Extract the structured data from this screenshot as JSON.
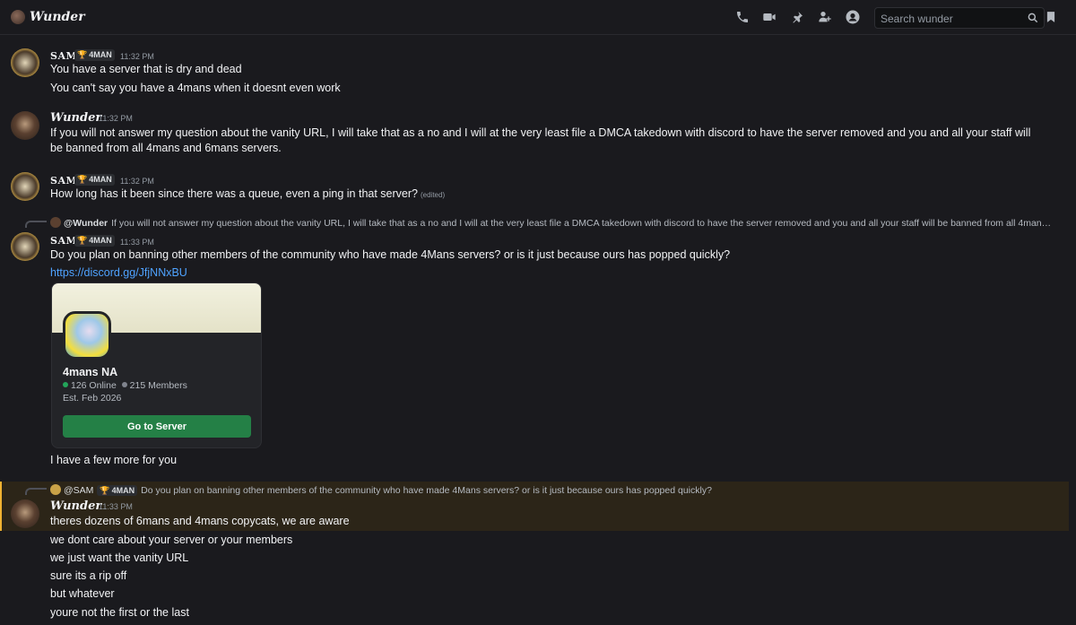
{
  "header": {
    "title": "Wunder",
    "search_placeholder": "Search wunder",
    "icons": [
      "voice-call-icon",
      "video-call-icon",
      "pin-icon",
      "add-friends-icon",
      "profile-icon",
      "search-icon",
      "inbox-icon"
    ]
  },
  "messages": [
    {
      "author": "SAM",
      "tag": "4MAN",
      "time": "11:32 PM",
      "lines": [
        "You have a server that is dry and dead",
        "You can't say you have a 4mans when it doesnt even work"
      ]
    },
    {
      "author": "Wunder",
      "time": "11:32 PM",
      "lines": [
        "If you will not answer my question about the vanity URL, I will take that as a no and I will at the very least file a DMCA takedown with discord to have the server removed and you and all your staff will be banned from all 4mans and 6mans servers."
      ]
    },
    {
      "author": "SAM",
      "tag": "4MAN",
      "time": "11:32 PM",
      "lines": [
        "How long has it been since there was a queue, even a ping in that server?"
      ],
      "edited": "(edited)"
    },
    {
      "reply": {
        "author": "@Wunder",
        "text": "If you will not answer my question about the vanity URL, I will take that as a no and I will at the very least file a DMCA takedown with discord to have the server removed and you and all your staff will be banned from all 4mans ..."
      },
      "author": "SAM",
      "tag": "4MAN",
      "time": "11:33 PM",
      "lines": [
        "Do you plan on banning other members of the community who have made 4Mans servers? or is it just because ours has popped quickly?"
      ],
      "link": "https://discord.gg/JfjNNxBU",
      "invite": {
        "name": "4mans NA",
        "online": "126 Online",
        "members": "215 Members",
        "established": "Est. Feb 2026",
        "button": "Go to Server"
      },
      "after": "I have a few more for you"
    },
    {
      "reply": {
        "author": "@SAM",
        "tag": "4MAN",
        "text": "Do you plan on banning other members of the community who have made 4Mans servers? or is it just because ours has popped quickly?"
      },
      "author": "Wunder",
      "time": "11:33 PM",
      "lines": [
        "theres dozens of 6mans and 4mans copycats, we are aware",
        "we dont care about your server or your members",
        "we just want the vanity URL",
        "sure its a rip off",
        "but whatever",
        "youre not the first or the last"
      ]
    }
  ],
  "colors": {
    "background": "#1a1a1e",
    "highlight": "#2c2518",
    "accent_gold": "#f0b232",
    "link": "#4fa3ff",
    "button_green": "#248046",
    "online": "#23a55a",
    "offline": "#80848e"
  }
}
